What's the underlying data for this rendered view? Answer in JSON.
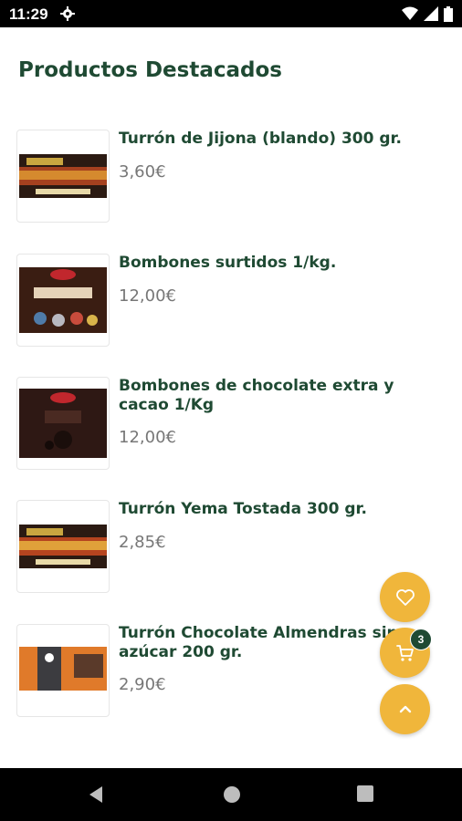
{
  "status_bar": {
    "time": "11:29",
    "icons": [
      "gear-icon",
      "wifi-icon",
      "signal-icon",
      "battery-icon"
    ]
  },
  "page": {
    "title": "Productos Destacados"
  },
  "products": [
    {
      "name": "Turrón de Jijona (blando) 300 gr.",
      "price": "3,60€"
    },
    {
      "name": "Bombones surtidos 1/kg.",
      "price": "12,00€"
    },
    {
      "name": "Bombones de chocolate extra y cacao 1/Kg",
      "price": "12,00€"
    },
    {
      "name": "Turrón Yema Tostada 300 gr.",
      "price": "2,85€"
    },
    {
      "name": "Turrón Chocolate Almendras sin azúcar 200 gr.",
      "price": "2,90€"
    }
  ],
  "fabs": {
    "favorites_icon": "heart-icon",
    "cart_icon": "cart-icon",
    "cart_count": "3",
    "scroll_top_icon": "chevron-up-icon"
  },
  "colors": {
    "brand_green": "#1f4a33",
    "accent_yellow": "#f0b63b",
    "price_gray": "#777777"
  },
  "nav_bar": {
    "icons": [
      "back-icon",
      "home-icon",
      "recents-icon"
    ]
  }
}
